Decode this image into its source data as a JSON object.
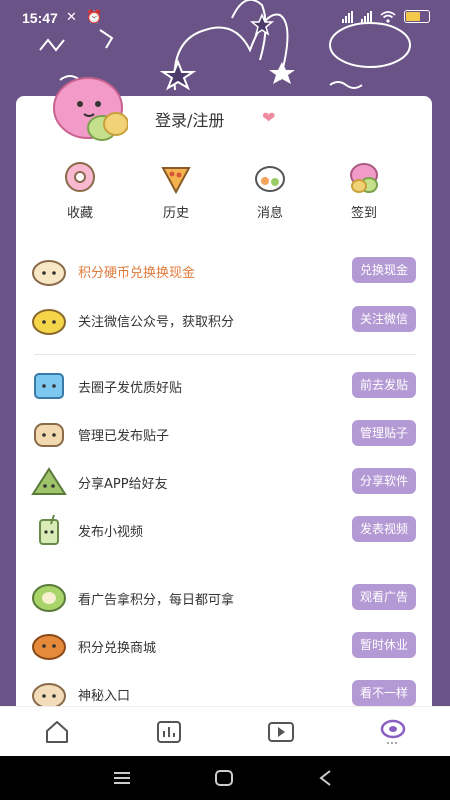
{
  "status_bar": {
    "time": "15:47",
    "battery_level": 0.6
  },
  "profile": {
    "login_label": "登录/注册"
  },
  "quick_actions": [
    {
      "label": "收藏",
      "icon": "donut-icon"
    },
    {
      "label": "历史",
      "icon": "pizza-icon"
    },
    {
      "label": "消息",
      "icon": "sushi-icon"
    },
    {
      "label": "签到",
      "icon": "mochi-icon"
    }
  ],
  "sections": [
    [
      {
        "text": "积分硬币兑换换现金",
        "button": "兑换现金",
        "accent": true,
        "icon": "bun-icon"
      },
      {
        "text": "关注微信公众号，获取积分",
        "button": "关注微信",
        "icon": "omelette-icon"
      }
    ],
    [
      {
        "text": "去圈子发优质好贴",
        "button": "前去发贴",
        "icon": "ice-cube-icon"
      },
      {
        "text": "管理已发布贴子",
        "button": "管理贴子",
        "icon": "toast-icon"
      },
      {
        "text": "分享APP给好友",
        "button": "分享软件",
        "icon": "rice-dumpling-icon"
      },
      {
        "text": "发布小视频",
        "button": "发表视频",
        "icon": "drink-icon"
      }
    ],
    [
      {
        "text": "看广告拿积分，每日都可拿",
        "button": "观看广告",
        "icon": "roll-cake-icon"
      },
      {
        "text": "积分兑换商城",
        "button": "暂时休业",
        "icon": "pancake-icon"
      },
      {
        "text": "神秘入口",
        "button": "看不一样",
        "icon": "steamed-bun-icon"
      }
    ]
  ],
  "colors": {
    "background": "#6a5387",
    "button": "#b49ad4",
    "accent_text": "#e07a3a",
    "active_tab": "#8a5fc4"
  },
  "tabs": [
    {
      "icon": "home-icon"
    },
    {
      "icon": "chart-icon"
    },
    {
      "icon": "video-icon"
    },
    {
      "icon": "profile-icon",
      "active": true
    }
  ]
}
